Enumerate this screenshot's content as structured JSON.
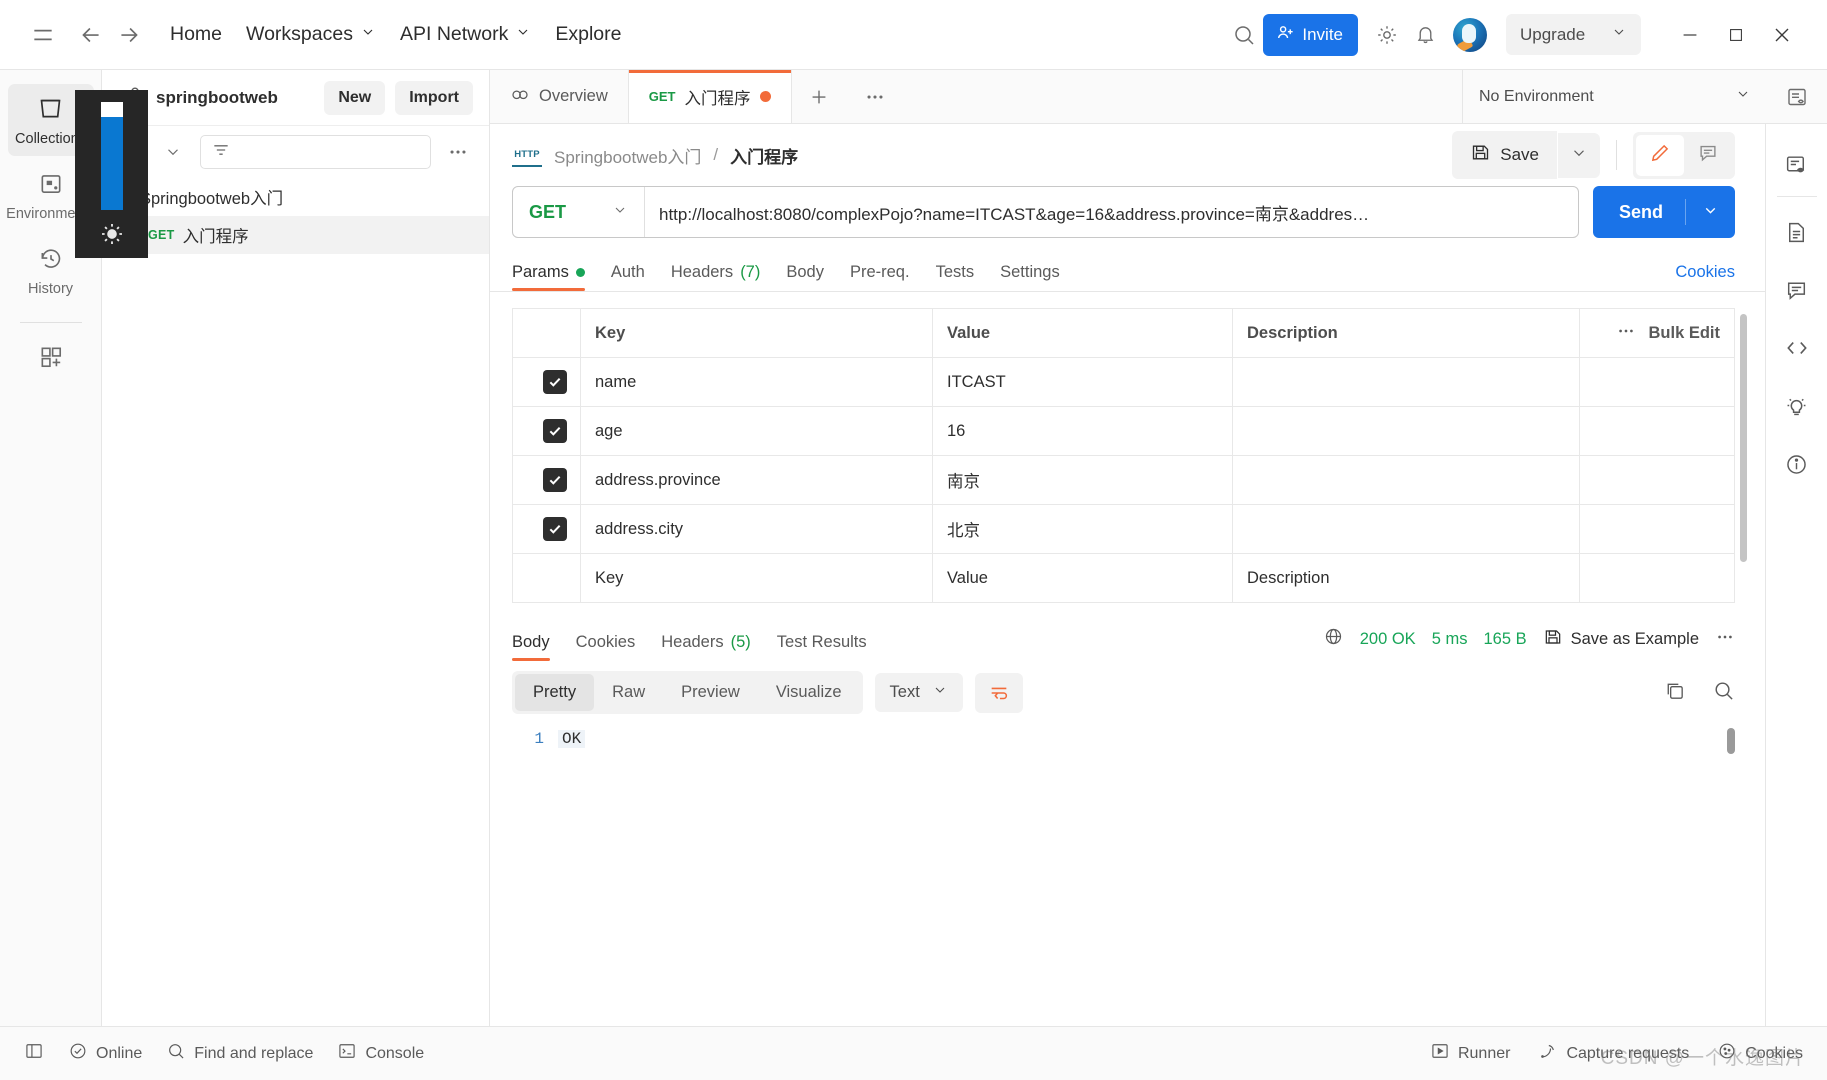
{
  "topbar": {
    "menu_icon": "hamburger-icon",
    "back_icon": "arrow-left-icon",
    "forward_icon": "arrow-right-icon",
    "home": "Home",
    "workspaces": "Workspaces",
    "api_network": "API Network",
    "explore": "Explore",
    "search_icon": "search-icon",
    "invite": "Invite",
    "settings_icon": "gear-icon",
    "notifications_icon": "bell-icon",
    "upgrade": "Upgrade",
    "minimize": "—",
    "maximize": "□",
    "close": "✕",
    "accent_blue": "#1a73e8"
  },
  "rail": {
    "items": [
      {
        "label": "Collections",
        "icon": "collections-icon",
        "active": true
      },
      {
        "label": "Environments",
        "icon": "environments-icon",
        "active": false
      },
      {
        "label": "History",
        "icon": "history-icon",
        "active": false
      }
    ],
    "add_icon": "add-blocks-icon"
  },
  "sidebar": {
    "workspace_name": "springbootweb",
    "new_label": "New",
    "import_label": "Import",
    "plus_icon": "plus-icon",
    "chevron_icon": "chevron-down-icon",
    "filter_icon": "filter-icon",
    "search_placeholder": "",
    "more_icon": "more-horizontal-icon",
    "collection": {
      "name": "Springbootweb入门",
      "expanded": true,
      "requests": [
        {
          "method": "GET",
          "name": "入门程序",
          "selected": true
        }
      ]
    }
  },
  "tabs": {
    "overview": "Overview",
    "overview_icon": "overview-icon",
    "request_tab": {
      "method": "GET",
      "name": "入门程序",
      "unsaved": true
    },
    "plus_icon": "plus-icon",
    "more_icon": "more-horizontal-icon",
    "environment": "No Environment",
    "env_caret": "⌄",
    "env_rail_icon": "env-quick-look-icon"
  },
  "request": {
    "breadcrumb_root": "Springbootweb入门",
    "breadcrumb_sep": "/",
    "breadcrumb_current": "入门程序",
    "http_badge": "HTTP",
    "save_label": "Save",
    "save_icon": "save-icon",
    "edit_icon": "pencil-icon",
    "comment_icon": "comment-icon",
    "method": "GET",
    "url": "http://localhost:8080/complexPojo?name=ITCAST&age=16&address.province=南京&addres…",
    "send_label": "Send",
    "subtabs": [
      {
        "label": "Params",
        "dot": true,
        "active": true
      },
      {
        "label": "Auth",
        "active": false
      },
      {
        "label": "Headers",
        "count": "(7)",
        "active": false
      },
      {
        "label": "Body",
        "active": false
      },
      {
        "label": "Pre-req.",
        "active": false
      },
      {
        "label": "Tests",
        "active": false
      },
      {
        "label": "Settings",
        "active": false
      }
    ],
    "cookies_link": "Cookies"
  },
  "params_table": {
    "columns": [
      "Key",
      "Value",
      "Description"
    ],
    "bulk_edit": "Bulk Edit",
    "more_icon": "more-horizontal-icon",
    "rows": [
      {
        "checked": true,
        "key": "name",
        "value": "ITCAST",
        "description": ""
      },
      {
        "checked": true,
        "key": "age",
        "value": "16",
        "description": ""
      },
      {
        "checked": true,
        "key": "address.province",
        "value": "南京",
        "description": ""
      },
      {
        "checked": true,
        "key": "address.city",
        "value": "北京",
        "description": ""
      }
    ],
    "placeholder_row": {
      "key": "Key",
      "value": "Value",
      "description": "Description"
    }
  },
  "response": {
    "tabs": [
      {
        "label": "Body",
        "active": true
      },
      {
        "label": "Cookies",
        "active": false
      },
      {
        "label": "Headers",
        "count": "(5)",
        "active": false
      },
      {
        "label": "Test Results",
        "active": false
      }
    ],
    "globe_icon": "globe-icon",
    "status": "200 OK",
    "time": "5 ms",
    "size": "165 B",
    "save_example": "Save as Example",
    "save_example_icon": "save-icon",
    "more_icon": "more-horizontal-icon",
    "viewer_modes": [
      {
        "label": "Pretty",
        "active": true
      },
      {
        "label": "Raw",
        "active": false
      },
      {
        "label": "Preview",
        "active": false
      },
      {
        "label": "Visualize",
        "active": false
      }
    ],
    "format": "Text",
    "wrap_icon": "wrap-lines-icon",
    "copy_icon": "copy-icon",
    "search_icon": "search-icon",
    "body_lines": [
      {
        "n": "1",
        "text": "OK"
      }
    ]
  },
  "right_rail": {
    "icons": [
      "quick-look-icon",
      "documentation-icon",
      "comments-icon",
      "code-icon",
      "info-tips-icon",
      "info-icon"
    ]
  },
  "statusbar": {
    "sidebar_toggle_icon": "panel-toggle-icon",
    "online": "Online",
    "online_icon": "check-circle-icon",
    "find_replace": "Find and replace",
    "find_icon": "search-icon",
    "console": "Console",
    "console_icon": "terminal-icon",
    "runner": "Runner",
    "runner_icon": "play-icon",
    "capture": "Capture requests",
    "capture_icon": "satellite-icon",
    "cookies": "Cookies",
    "cookies_icon": "cookie-icon"
  },
  "overlay": {
    "type": "brightness-osd",
    "icon": "sun-icon",
    "level_percent": 86,
    "bar_color": "#0a78d1",
    "panel_color": "#262626"
  },
  "watermark": {
    "text": "CSDN @一个水逸图片"
  }
}
